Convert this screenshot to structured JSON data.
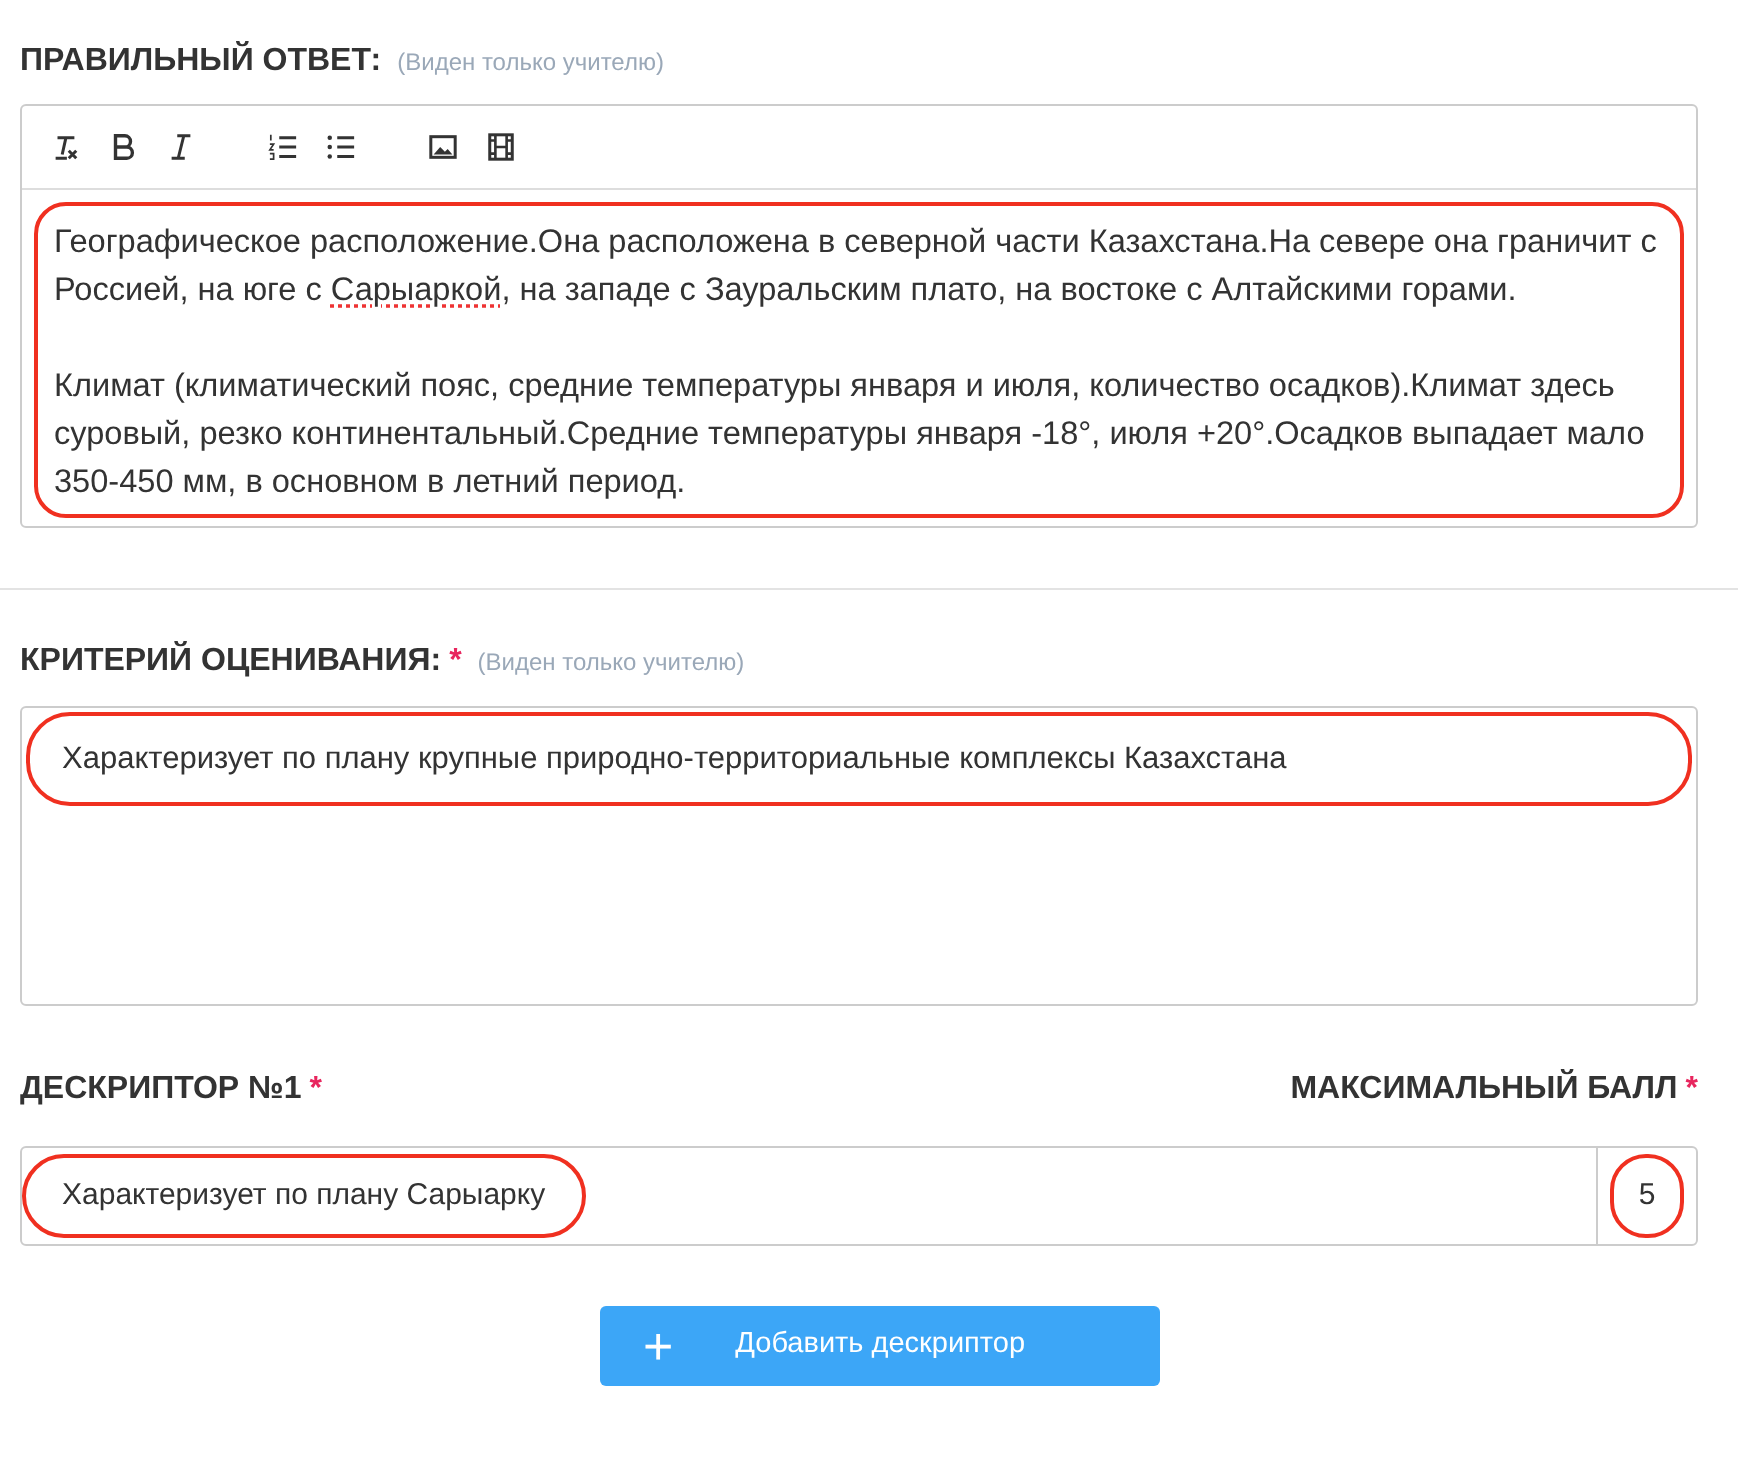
{
  "correct_answer": {
    "label": "ПРАВИЛЬНЫЙ ОТВЕТ:",
    "note": "(Виден только учителю)",
    "toolbar": [
      {
        "kind": "clear-format"
      },
      {
        "kind": "bold"
      },
      {
        "kind": "italic"
      },
      {
        "kind": "gap"
      },
      {
        "kind": "numbered-list"
      },
      {
        "kind": "bullet-list"
      },
      {
        "kind": "gap"
      },
      {
        "kind": "image"
      },
      {
        "kind": "video"
      }
    ],
    "highlighted": true,
    "paragraphs": [
      [
        {
          "text": "Географическое расположение.Она расположена в северной части Казахстана.На севере она граничит с Россией, на юге с ",
          "misspelled": false
        },
        {
          "text": "Сарыаркой",
          "misspelled": true
        },
        {
          "text": ", на западе с Зауральским плато, на востоке с Алтайскими горами.",
          "misspelled": false
        }
      ],
      [
        {
          "text": "Климат (климатический пояс, средние температуры января и июля, количество осадков).Климат здесь суровый, резко континентальный.Средние температуры января -18°, июля +20°.Осадков выпадает мало 350-450 мм, в основном в летний период.",
          "misspelled": false
        }
      ]
    ]
  },
  "criterion": {
    "label": "КРИТЕРИЙ ОЦЕНИВАНИЯ:",
    "required_mark": "*",
    "note": "(Виден только учителю)",
    "value": "Характеризует по плану крупные природно-территориальные комплексы Казахстана",
    "highlighted": true
  },
  "descriptor": {
    "label": "ДЕСКРИПТОР №1",
    "required_mark": "*",
    "score_label": "МАКСИМАЛЬНЫЙ БАЛЛ",
    "score_required_mark": "*",
    "value": "Характеризует по плану Сарыарку",
    "highlighted": true,
    "score": "5",
    "score_highlighted": true
  },
  "add_button": {
    "icon": "+",
    "label": "Добавить дескриптор"
  }
}
